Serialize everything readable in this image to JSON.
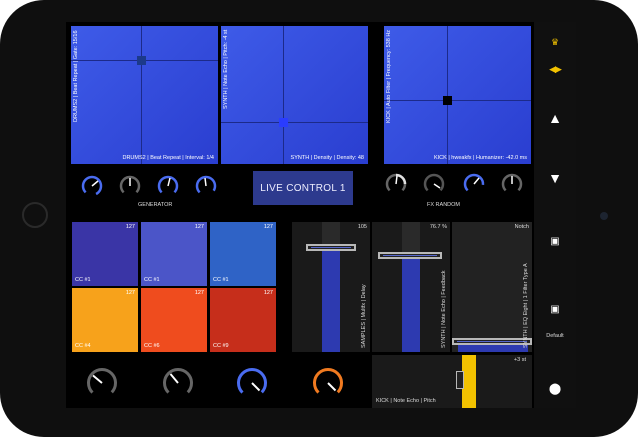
{
  "pads": [
    {
      "vertical_label": "DRUMS2 | Beat Repeat | Gate: 15/16",
      "bottom_label": "DRUMS2 | Beat Repeat | Interval: 1/4"
    },
    {
      "vertical_label": "SYNTH | Note Echo | Pitch: -4 st",
      "bottom_label": "SYNTH | Density | Density: 48"
    },
    {
      "vertical_label": "KICK | Auto Filter | Frequency: 538 Hz",
      "bottom_label": "KICK | hweakfx | Humanizer: -42.0 ms"
    }
  ],
  "sections": {
    "generator": "GENERATOR",
    "fx_random": "FX RANDOM"
  },
  "live_control": {
    "label": "LIVE CONTROL 1"
  },
  "grid": [
    {
      "value": "127",
      "label": "CC #1",
      "color": "#3a35a6"
    },
    {
      "value": "127",
      "label": "CC #1",
      "color": "#4b55c8"
    },
    {
      "value": "127",
      "label": "CC #1",
      "color": "#2f63c6"
    },
    {
      "value": "127",
      "label": "CC #4",
      "color": "#f7a21b"
    },
    {
      "value": "127",
      "label": "CC #6",
      "color": "#ef4c1e"
    },
    {
      "value": "127",
      "label": "CC #9",
      "color": "#c62e1b"
    }
  ],
  "faders": [
    {
      "value": "105",
      "label": "SAMPLES | Multfx | Delay",
      "level": 0.82
    },
    {
      "value": "76.7 %",
      "label": "SYNTH | Note Echo | Feedback",
      "level": 0.77
    },
    {
      "value": "Notch",
      "label": "SYNTH | EQ Eight | 1 Filter Type A",
      "level": 0.08
    }
  ],
  "pitch_fader": {
    "value": "+3 st",
    "label": "KICK | Note Echo | Pitch"
  },
  "sidebar": {
    "default_label": "Default"
  },
  "colors": {
    "accent_blue": "#3e5be8",
    "knob_blue": "#4a6cf0",
    "knob_orange": "#f07a20",
    "yellow": "#f2c200"
  }
}
